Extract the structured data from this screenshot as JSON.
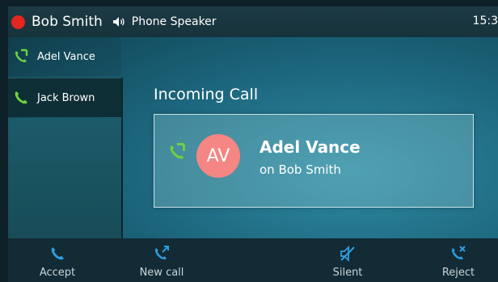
{
  "statusbar": {
    "user": "Bob Smith",
    "audio_device": "Phone Speaker",
    "time": "15:3"
  },
  "sidebar": {
    "lines": [
      {
        "label": "Adel Vance",
        "icon": "incoming-call-icon"
      },
      {
        "label": "Jack Brown",
        "icon": "phone-icon"
      }
    ]
  },
  "main": {
    "title": "Incoming Call",
    "caller": {
      "initials": "AV",
      "name": "Adel Vance",
      "subtitle": "on Bob Smith"
    }
  },
  "softkeys": [
    {
      "label": "Accept",
      "icon": "phone-icon"
    },
    {
      "label": "New call",
      "icon": "new-call-icon"
    },
    {
      "label": "Silent",
      "icon": "mute-icon"
    },
    {
      "label": "Reject",
      "icon": "reject-icon"
    }
  ],
  "colors": {
    "status_dot": "#e3261f",
    "call_green": "#6ed23c",
    "softkey_blue": "#2f9ee0",
    "avatar_bg": "#f48683"
  }
}
